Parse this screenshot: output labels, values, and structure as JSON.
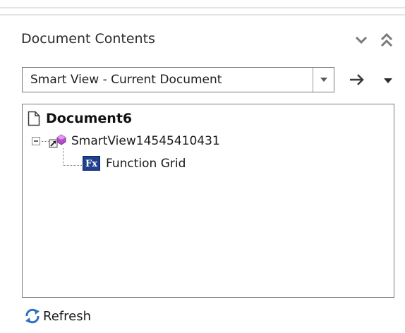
{
  "panel": {
    "title": "Document Contents"
  },
  "selector": {
    "value": "Smart View - Current Document"
  },
  "tree": {
    "document": "Document6",
    "connection": "SmartView14545410431",
    "item": "Function Grid"
  },
  "footer": {
    "refresh_label": "Refresh"
  },
  "colors": {
    "border": "#7a7a7a",
    "chevron": "#7a7a7a",
    "fx_icon_bg": "#1f3f8f",
    "connection_gem": "#b44fc8",
    "refresh_icon": "#2f6fc4"
  },
  "icons": {
    "collapse": "chevron-down-icon",
    "expand": "double-chevron-up-icon",
    "dropdown": "dropdown-arrow-icon",
    "go": "arrow-right-icon",
    "menu": "caret-down-icon",
    "document": "document-icon",
    "tree_toggle": "tree-collapse-icon",
    "connection": "connection-icon",
    "function": "function-icon",
    "refresh": "refresh-icon"
  }
}
